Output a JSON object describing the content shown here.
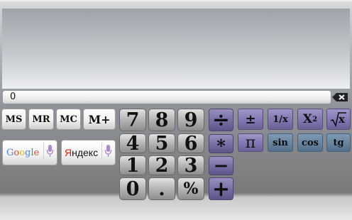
{
  "display": {
    "value": "0"
  },
  "memory": {
    "ms": "MS",
    "mr": "MR",
    "mc": "MC",
    "mplus": "M+"
  },
  "search": {
    "google": [
      "G",
      "o",
      "o",
      "g",
      "l",
      "e"
    ],
    "yandex": "Яндекс"
  },
  "digits": {
    "d7": "7",
    "d8": "8",
    "d9": "9",
    "d4": "4",
    "d5": "5",
    "d6": "6",
    "d1": "1",
    "d2": "2",
    "d3": "3",
    "d0": "0",
    "dot": ".",
    "pct": "%"
  },
  "ops": {
    "divide": "÷",
    "multiply": "*",
    "minus": "−",
    "plus": "+"
  },
  "functions": {
    "plusminus": "±",
    "pi": "π",
    "reciprocal": "1/x",
    "square_base": "X",
    "square_exp": "2",
    "sqrt": "x"
  },
  "trig": {
    "sin": "sin",
    "cos": "cos",
    "tg": "tg"
  },
  "colors": {
    "operator": "#7b6fa6",
    "trig": "#6a859f",
    "google_blue": "#4285f4",
    "google_red": "#ea4335",
    "google_yellow": "#fbbc05",
    "google_green": "#34a853",
    "yandex_red": "#e61400"
  }
}
